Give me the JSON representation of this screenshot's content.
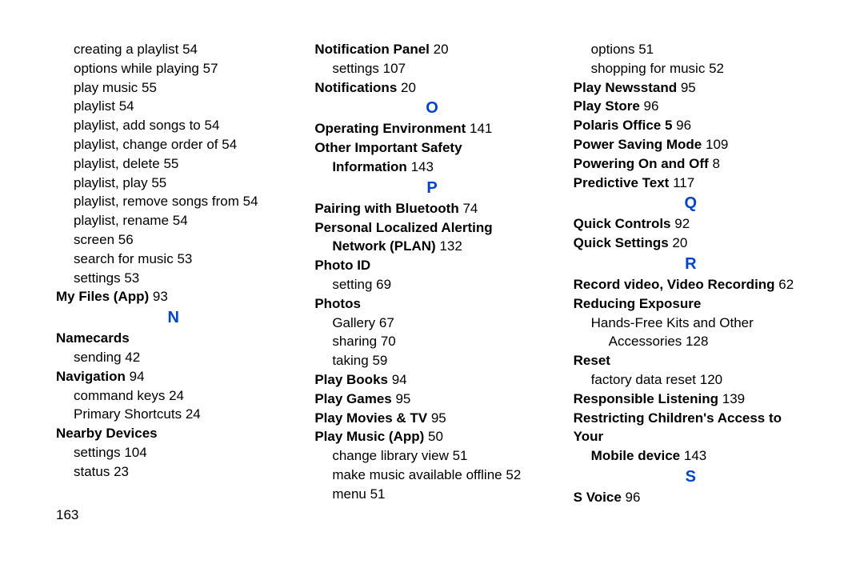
{
  "page_number": "163",
  "col1": {
    "creating_playlist": "creating a playlist",
    "creating_playlist_pg": "54",
    "options_playing": "options while playing",
    "options_playing_pg": "57",
    "play_music": "play music",
    "play_music_pg": "55",
    "playlist": "playlist",
    "playlist_pg": "54",
    "playlist_add": "playlist, add songs to",
    "playlist_add_pg": "54",
    "playlist_change": "playlist, change order of",
    "playlist_change_pg": "54",
    "playlist_delete": "playlist, delete",
    "playlist_delete_pg": "55",
    "playlist_play": "playlist, play",
    "playlist_play_pg": "55",
    "playlist_remove": "playlist, remove songs from",
    "playlist_remove_pg": "54",
    "playlist_rename": "playlist, rename",
    "playlist_rename_pg": "54",
    "screen": "screen",
    "screen_pg": "56",
    "search_music": "search for music",
    "search_music_pg": "53",
    "settings": "settings",
    "settings_pg": "53",
    "my_files": "My Files (App)",
    "my_files_pg": "93",
    "letter_n": "N",
    "namecards": "Namecards",
    "sending": "sending",
    "sending_pg": "42",
    "navigation": "Navigation",
    "navigation_pg": "94",
    "command_keys": "command keys",
    "command_keys_pg": "24",
    "primary_shortcuts": "Primary Shortcuts",
    "primary_shortcuts_pg": "24",
    "nearby_devices": "Nearby Devices",
    "nd_settings": "settings",
    "nd_settings_pg": "104",
    "nd_status": "status",
    "nd_status_pg": "23"
  },
  "col2": {
    "notification_panel": "Notification Panel",
    "notification_panel_pg": "20",
    "np_settings": "settings",
    "np_settings_pg": "107",
    "notifications": "Notifications",
    "notifications_pg": "20",
    "letter_o": "O",
    "operating_env": "Operating Environment",
    "operating_env_pg": "141",
    "other_safety1": "Other Important Safety",
    "other_safety2": "Information",
    "other_safety_pg": "143",
    "letter_p": "P",
    "pairing_bt": "Pairing with Bluetooth",
    "pairing_bt_pg": "74",
    "plan1": "Personal Localized Alerting",
    "plan2": "Network (PLAN)",
    "plan_pg": "132",
    "photo_id": "Photo ID",
    "pi_setting": "setting",
    "pi_setting_pg": "69",
    "photos": "Photos",
    "gallery": "Gallery",
    "gallery_pg": "67",
    "sharing": "sharing",
    "sharing_pg": "70",
    "taking": "taking",
    "taking_pg": "59",
    "play_books": "Play Books",
    "play_books_pg": "94",
    "play_games": "Play Games",
    "play_games_pg": "95",
    "play_movies": "Play Movies & TV",
    "play_movies_pg": "95",
    "play_music_app": "Play Music (App)",
    "play_music_app_pg": "50",
    "change_lib": "change library view",
    "change_lib_pg": "51",
    "make_offline": "make music available offline",
    "make_offline_pg": "52",
    "menu": "menu",
    "menu_pg": "51"
  },
  "col3": {
    "options": "options",
    "options_pg": "51",
    "shopping": "shopping for music",
    "shopping_pg": "52",
    "play_newsstand": "Play Newsstand",
    "play_newsstand_pg": "95",
    "play_store": "Play Store",
    "play_store_pg": "96",
    "polaris": "Polaris Office 5",
    "polaris_pg": "96",
    "power_saving": "Power Saving Mode",
    "power_saving_pg": "109",
    "power_onoff": "Powering On and Off",
    "power_onoff_pg": "8",
    "predictive": "Predictive Text",
    "predictive_pg": "117",
    "letter_q": "Q",
    "quick_controls": "Quick Controls",
    "quick_controls_pg": "92",
    "quick_settings": "Quick Settings",
    "quick_settings_pg": "20",
    "letter_r": "R",
    "record_video": "Record video, Video Recording",
    "record_video_pg": "62",
    "reducing_exp": "Reducing Exposure",
    "hands_free1": "Hands-Free Kits and Other",
    "hands_free2": "Accessories",
    "hands_free_pg": "128",
    "reset": "Reset",
    "factory_reset": "factory data reset",
    "factory_reset_pg": "120",
    "resp_listen": "Responsible Listening",
    "resp_listen_pg": "139",
    "restrict1": "Restricting Children's Access to Your",
    "restrict2": "Mobile device",
    "restrict_pg": "143",
    "letter_s": "S",
    "s_voice": "S Voice",
    "s_voice_pg": "96"
  }
}
